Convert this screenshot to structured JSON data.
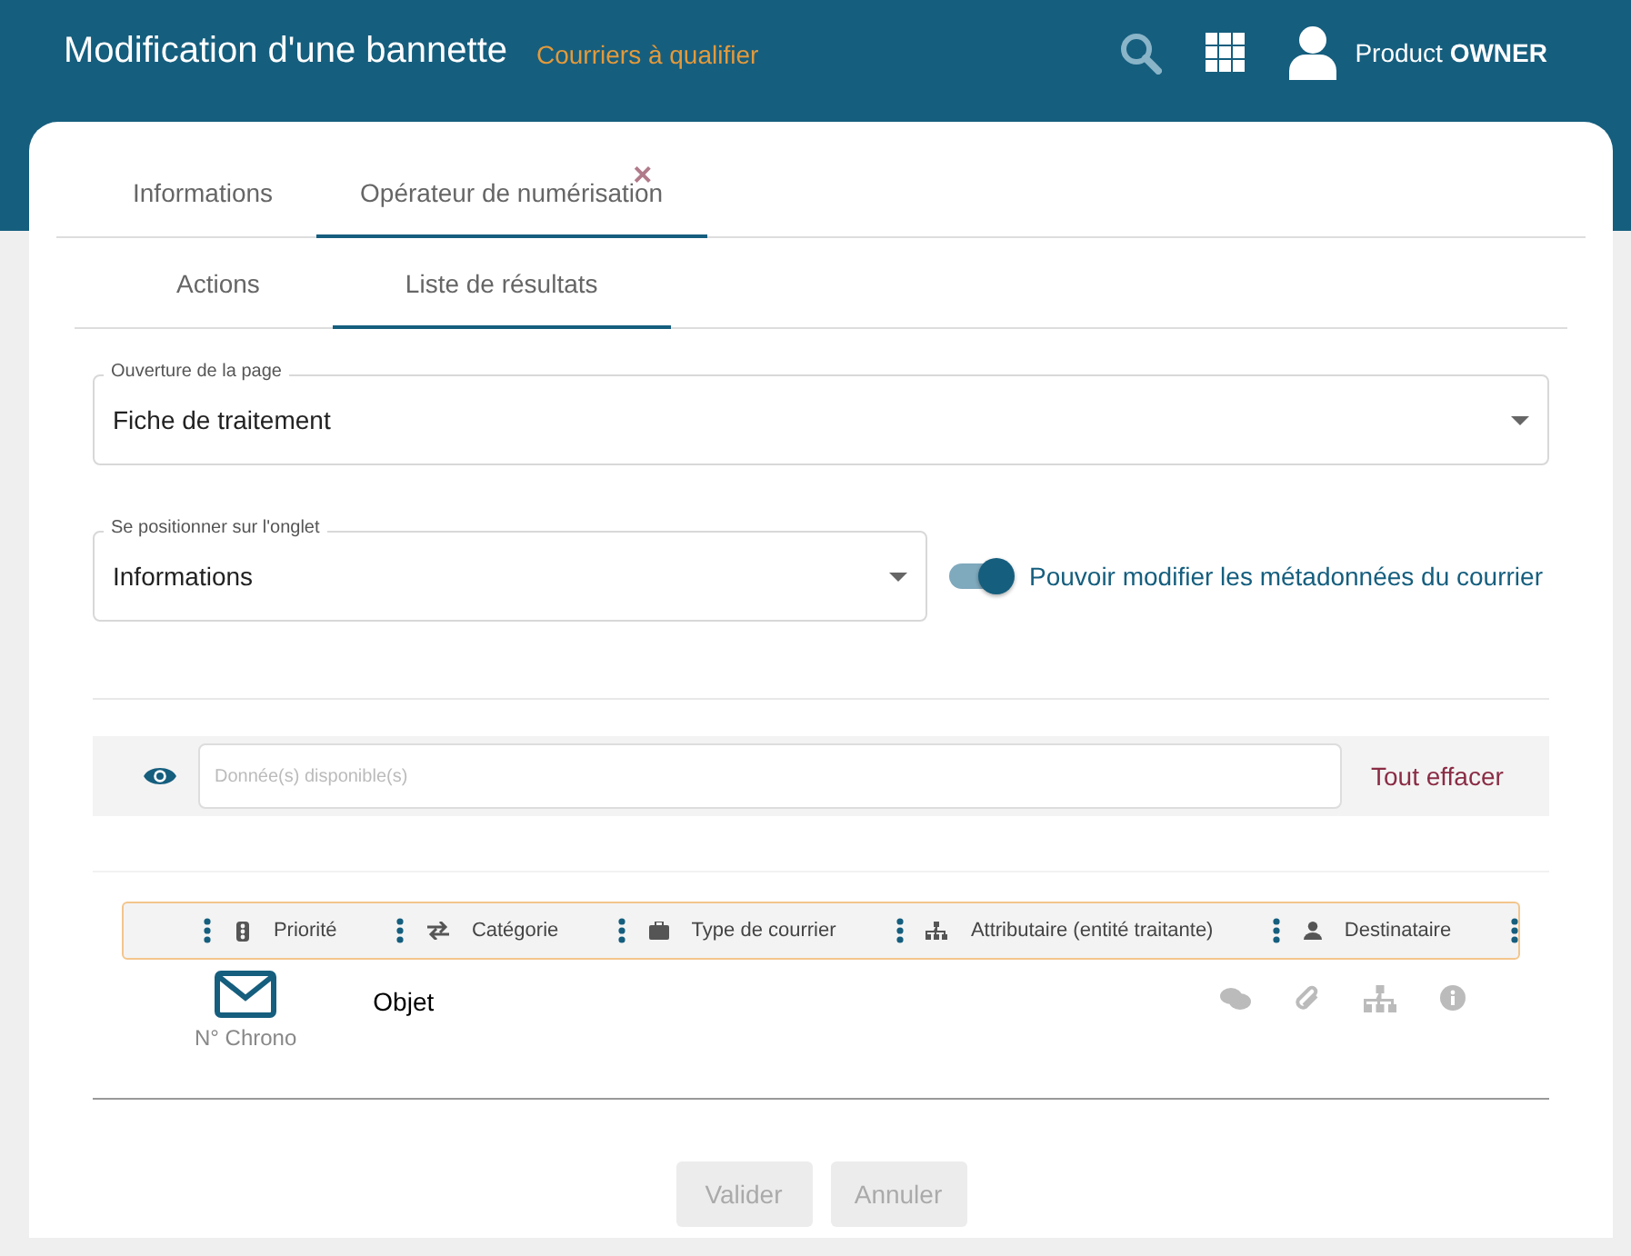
{
  "header": {
    "title": "Modification d'une bannette",
    "subtitle": "Courriers à qualifier",
    "user": {
      "first": "Product",
      "last": "OWNER"
    }
  },
  "tabs": [
    {
      "label": "Informations",
      "selected": false
    },
    {
      "label": "Opérateur de numérisation",
      "selected": true,
      "close": "×"
    }
  ],
  "subtabs": [
    {
      "label": "Actions",
      "selected": false
    },
    {
      "label": "Liste de résultats",
      "selected": true
    }
  ],
  "page_opening": {
    "label": "Ouverture de la page",
    "value": "Fiche de traitement"
  },
  "tab_position": {
    "label": "Se positionner sur l'onglet",
    "value": "Informations"
  },
  "toggle": {
    "label": "Pouvoir modifier les métadonnées du courrier",
    "on": true
  },
  "data_filter": {
    "placeholder": "Donnée(s) disponible(s)",
    "clear": "Tout effacer"
  },
  "columns": [
    {
      "label": "Priorité"
    },
    {
      "label": "Catégorie"
    },
    {
      "label": "Type de courrier"
    },
    {
      "label": "Attributaire (entité traitante)"
    },
    {
      "label": "Destinataire"
    }
  ],
  "preview_row": {
    "chrono": "N° Chrono",
    "subject": "Objet"
  },
  "buttons": [
    {
      "label": "Valider",
      "disabled": true
    },
    {
      "label": "Annuler",
      "disabled": true
    }
  ]
}
